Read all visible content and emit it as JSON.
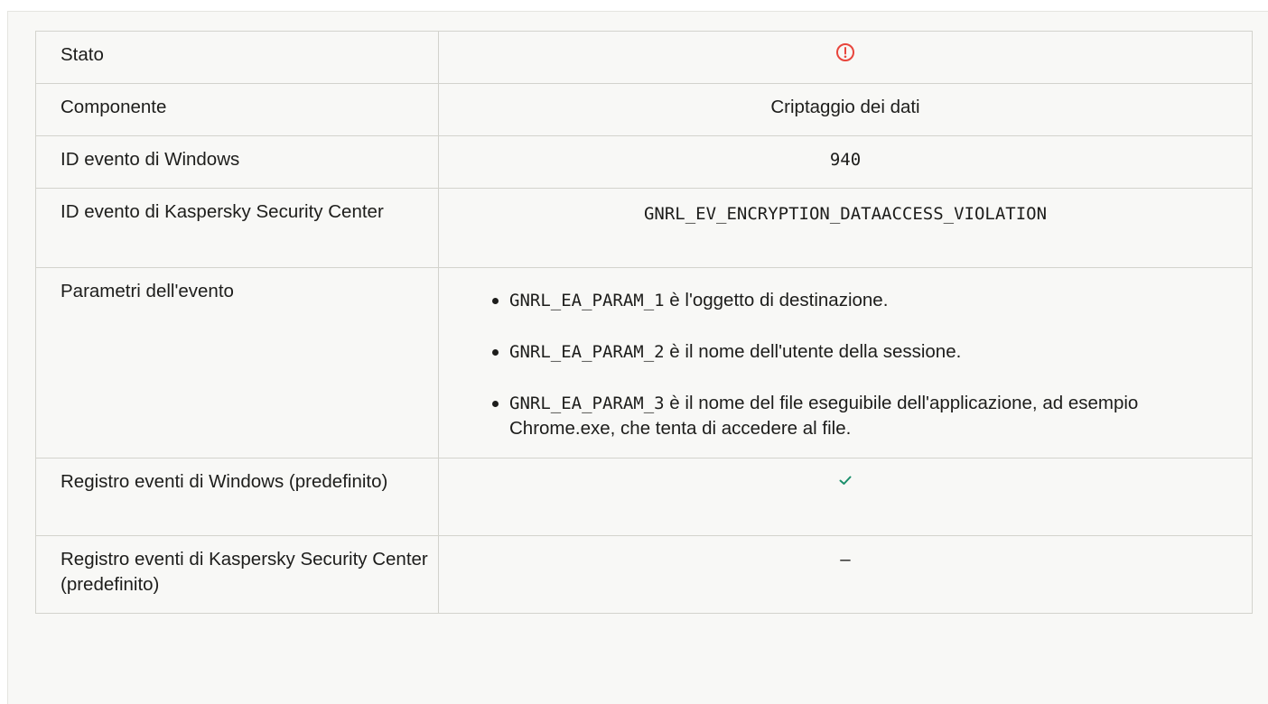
{
  "table": {
    "rows": {
      "stato": {
        "label": "Stato",
        "icon": "alert-circle-icon",
        "icon_color": "#e8453c"
      },
      "componente": {
        "label": "Componente",
        "value": "Criptaggio dei dati"
      },
      "win_event_id": {
        "label": "ID evento di Windows",
        "value": "940"
      },
      "ksc_event_id": {
        "label": "ID evento di Kaspersky Security Center",
        "value": "GNRL_EV_ENCRYPTION_DATAACCESS_VIOLATION"
      },
      "parametri": {
        "label": "Parametri dell'evento",
        "items": [
          {
            "code": "GNRL_EA_PARAM_1",
            "text": " è l'oggetto di destinazione."
          },
          {
            "code": "GNRL_EA_PARAM_2",
            "text": " è il nome dell'utente della sessione."
          },
          {
            "code": "GNRL_EA_PARAM_3",
            "text": " è il nome del file eseguibile dell'applicazione, ad esempio Chrome.exe, che tenta di accedere al file."
          }
        ]
      },
      "win_log": {
        "label": "Registro eventi di Windows (predefinito)",
        "icon": "check-icon",
        "icon_color": "#1a8f6b"
      },
      "ksc_log": {
        "label": "Registro eventi di Kaspersky Security Center (predefinito)",
        "value": "–"
      }
    }
  }
}
